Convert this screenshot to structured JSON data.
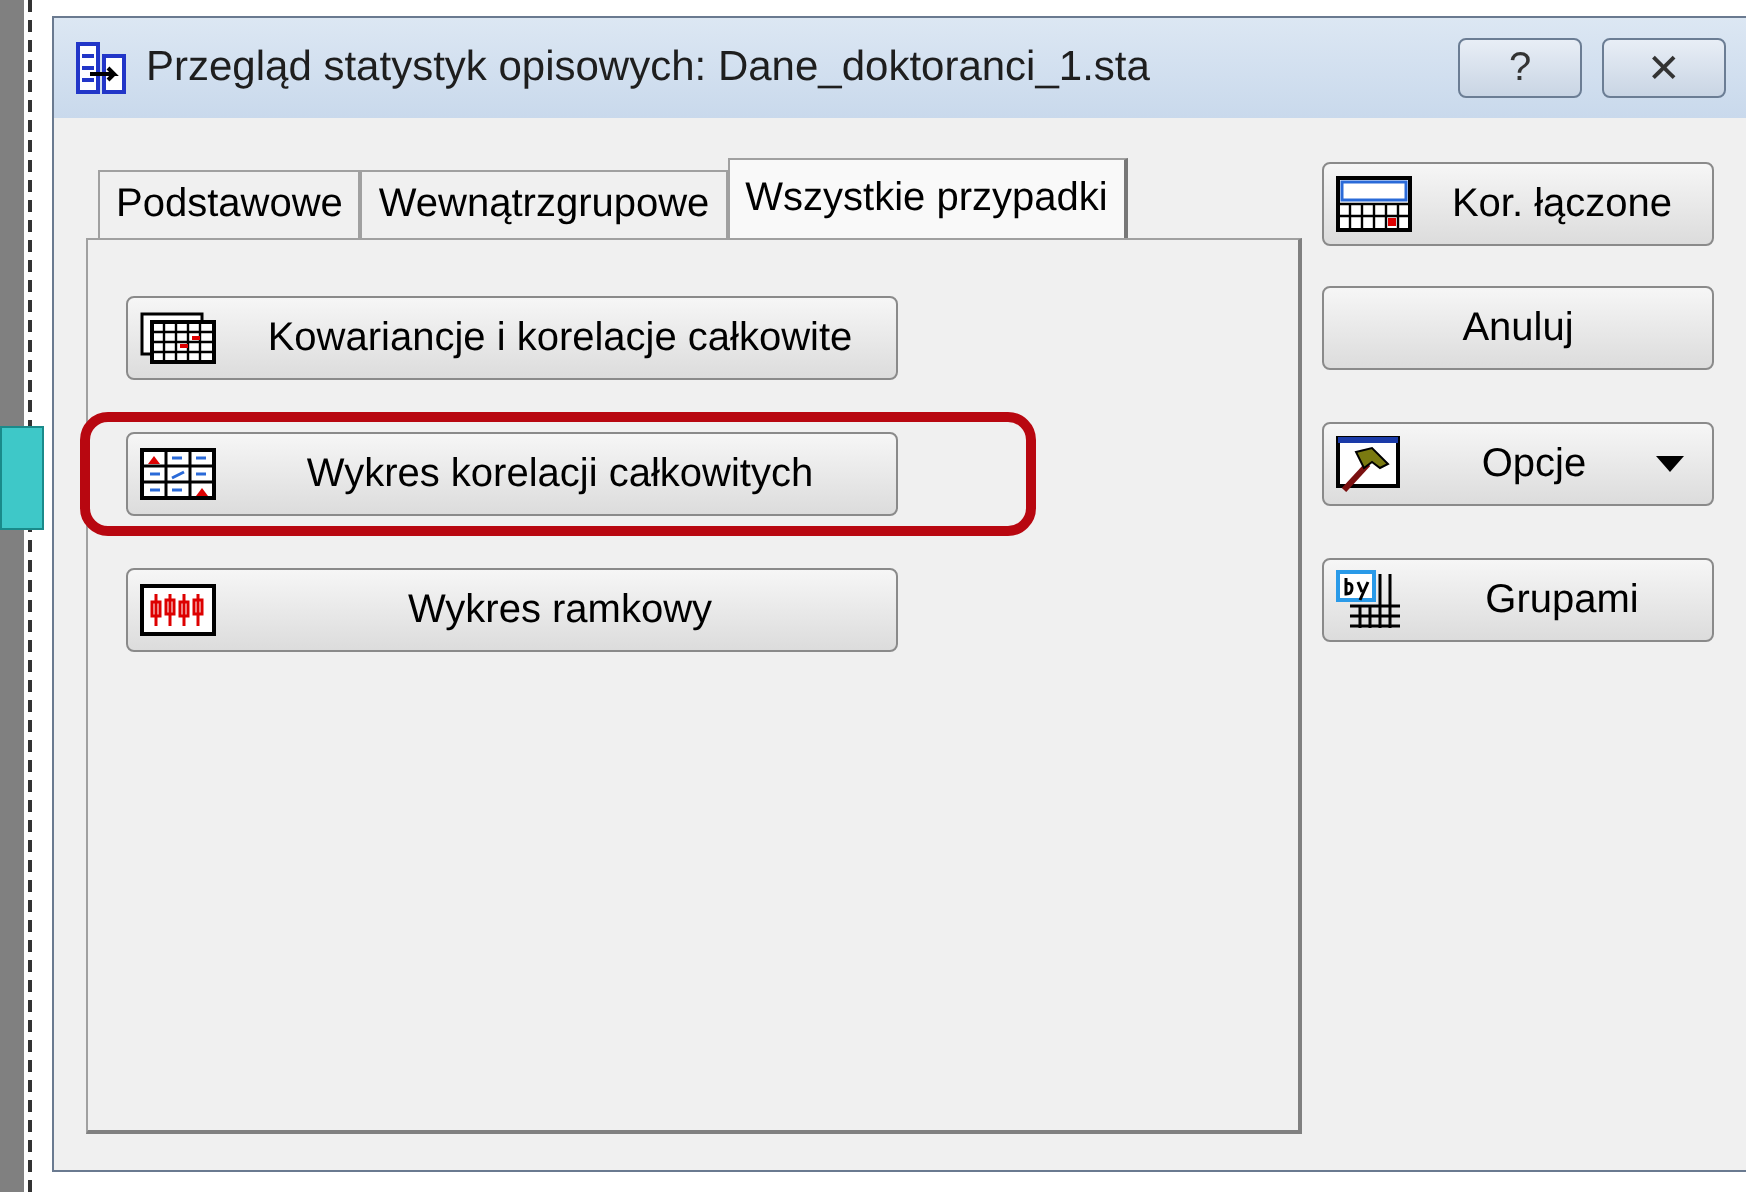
{
  "window": {
    "title": "Przegląd statystyk opisowych: Dane_doktoranci_1.sta",
    "help": "?",
    "close": "✕"
  },
  "tabs": [
    {
      "label": "Podstawowe",
      "selected": false
    },
    {
      "label": "Wewnątrzgrupowe",
      "selected": false
    },
    {
      "label": "Wszystkie przypadki",
      "selected": true
    }
  ],
  "panel_buttons": [
    {
      "label": "Kowariancje i korelacje całkowite",
      "kind": "table",
      "highlighted": false
    },
    {
      "label": "Wykres korelacji całkowitych",
      "kind": "matrix",
      "highlighted": true
    },
    {
      "label": "Wykres ramkowy",
      "kind": "boxplot",
      "highlighted": false
    }
  ],
  "side_buttons": [
    {
      "label": "Kor. łączone",
      "kind": "summ",
      "dropdown": false
    },
    {
      "label": "Anuluj",
      "kind": "plain",
      "dropdown": false
    },
    {
      "label": "Opcje",
      "kind": "hammer",
      "dropdown": true
    },
    {
      "label": "Grupami",
      "kind": "by",
      "dropdown": false
    }
  ]
}
